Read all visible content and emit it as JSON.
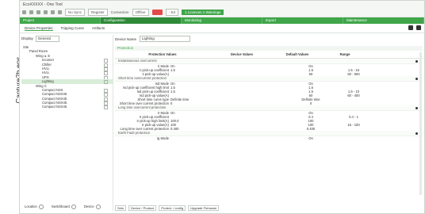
{
  "caption": "Capture2b.eps",
  "window": {
    "title": "EcoXXXXX - One Tool"
  },
  "toolbar": {
    "no_sync": "No Sync",
    "register": "Register",
    "connection_label": "Connection",
    "connection_value": "Offline",
    "user": "- Ed",
    "license": "1 Licences 1 Warnings"
  },
  "tabs": [
    "Project",
    "Configuration",
    "Monitoring",
    "Export",
    "Maintenance"
  ],
  "active_tab": "Configuration",
  "subtabs": [
    "Device Properties",
    "Tripping Curve",
    "Artifacts"
  ],
  "display": {
    "label": "Display",
    "value": "General"
  },
  "tree": [
    {
      "label": "Site",
      "indent": 0,
      "icon": false
    },
    {
      "label": "Panel Room",
      "indent": 1,
      "icon": false
    },
    {
      "label": "Wing a. E",
      "indent": 2,
      "icon": false
    },
    {
      "label": "Incomer",
      "indent": 3,
      "icon": true
    },
    {
      "label": "Chiller",
      "indent": 3,
      "icon": true
    },
    {
      "label": "HVLi",
      "indent": 3,
      "icon": true
    },
    {
      "label": "HVLi",
      "indent": 3,
      "icon": true
    },
    {
      "label": "UPS",
      "indent": 3,
      "icon": true
    },
    {
      "label": "Lighting",
      "indent": 3,
      "icon": true,
      "selected": true
    },
    {
      "label": "Wing C",
      "indent": 2,
      "icon": false
    },
    {
      "label": "Compact NSX",
      "indent": 3,
      "icon": true
    },
    {
      "label": "Compact NSX45",
      "indent": 3,
      "icon": true
    },
    {
      "label": "Compact NSX45",
      "indent": 3,
      "icon": true
    },
    {
      "label": "Compact NSX45",
      "indent": 3,
      "icon": true
    },
    {
      "label": "Compact NSX45",
      "indent": 3,
      "icon": true
    }
  ],
  "left_footer": [
    "Location",
    "Switchboard",
    "Device"
  ],
  "device_name": {
    "label": "Device Name",
    "value": "Lighting"
  },
  "protection_title": "Protection",
  "columns": [
    "Protection Values",
    "Device Values",
    "Default Values",
    "Range"
  ],
  "sections": [
    {
      "title": "Instantaneous overcurrent",
      "rows": [
        {
          "label": "Ii Mode",
          "ctrl": "On",
          "def": "On",
          "range": ""
        },
        {
          "label": "Ii pick-up coefficient",
          "ctrl": "1.5",
          "def": "1.5",
          "range": "1.5 - 15"
        },
        {
          "label": "Ii pick-up value(A)",
          "ctrl": "",
          "def": "60",
          "range": "60 - 600"
        }
      ]
    },
    {
      "title": "Short time overcurrent protection",
      "rows": [
        {
          "label": "Isd Mode",
          "ctrl": "On",
          "def": "On",
          "range": ""
        },
        {
          "label": "Isd pick-up coefficient high limit",
          "ctrl": "1.5",
          "def": "1.5",
          "range": ""
        },
        {
          "label": "Isd pick-up coefficient",
          "ctrl": "1.5",
          "def": "1.5",
          "range": "1.5 - 10"
        },
        {
          "label": "Isd pick-up value(A)",
          "ctrl": "",
          "def": "60",
          "range": "60 - 400"
        },
        {
          "label": "Short time curve type",
          "ctrl": "Definite time",
          "def": "Definite time",
          "range": ""
        },
        {
          "label": "Short time over current protection",
          "ctrl": "0",
          "def": "0",
          "range": ""
        }
      ]
    },
    {
      "title": "Long time overcurrent protection",
      "rows": [
        {
          "label": "Ir Mode",
          "ctrl": "On",
          "def": "On",
          "range": ""
        },
        {
          "label": "Ir pick-up coefficient",
          "ctrl": "",
          "def": "0.4",
          "range": "0.4 - 1"
        },
        {
          "label": "Ir pick-up high limit(A)",
          "ctrl": "100.0",
          "def": "100",
          "range": ""
        },
        {
          "label": "Ir pick-up value(A)",
          "ctrl": "100",
          "def": "100",
          "range": "16 - 100"
        },
        {
          "label": "Long time over current protection",
          "ctrl": "0.400",
          "def": "0.400",
          "range": ""
        }
      ]
    },
    {
      "title": "Earth Fault protection",
      "rows": [
        {
          "label": "Ig Mode",
          "ctrl": "",
          "def": "On",
          "range": ""
        }
      ]
    }
  ],
  "bottom_tabs": [
    "Sets",
    "Device / Product",
    "Protect. / config",
    "Upgrade Firmware"
  ]
}
